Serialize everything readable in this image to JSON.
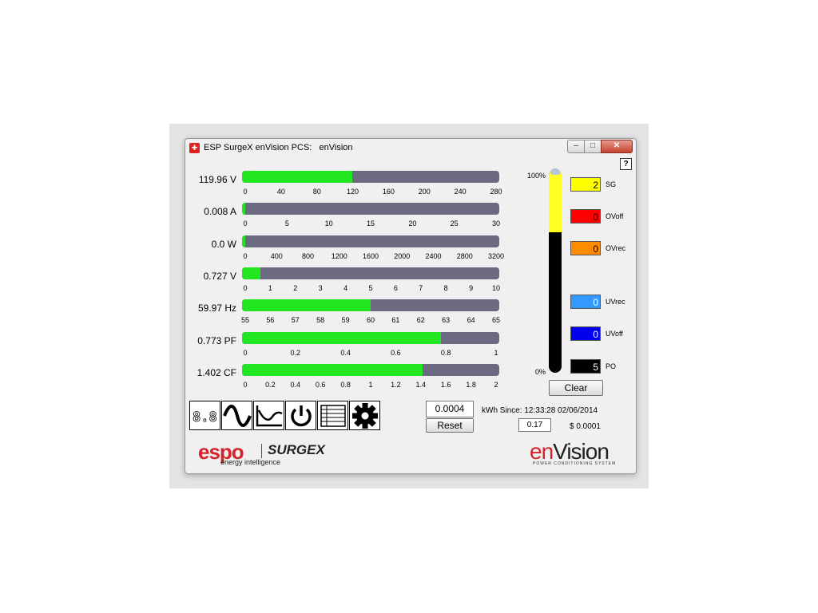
{
  "window": {
    "title": "ESP SurgeX enVision PCS:   enVision",
    "app_icon": "esp-logo-icon",
    "buttons": {
      "minimize": "–",
      "maximize": "□",
      "close": "✕"
    },
    "help_label": "?"
  },
  "meters": [
    {
      "value": "119.96 V",
      "fill": 0.43,
      "ticks": [
        "0",
        "40",
        "80",
        "120",
        "160",
        "200",
        "240",
        "280"
      ]
    },
    {
      "value": "0.008 A",
      "fill": 0.012,
      "ticks": [
        "0",
        "5",
        "10",
        "15",
        "20",
        "25",
        "30"
      ]
    },
    {
      "value": "0.0 W",
      "fill": 0.012,
      "ticks": [
        "0",
        "400",
        "800",
        "1200",
        "1600",
        "2000",
        "2400",
        "2800",
        "3200"
      ]
    },
    {
      "value": "0.727 V",
      "fill": 0.0727,
      "ticks": [
        "0",
        "1",
        "2",
        "3",
        "4",
        "5",
        "6",
        "7",
        "8",
        "9",
        "10"
      ]
    },
    {
      "value": "59.97 Hz",
      "fill": 0.4985,
      "ticks": [
        "55",
        "56",
        "57",
        "58",
        "59",
        "60",
        "61",
        "62",
        "63",
        "64",
        "65"
      ]
    },
    {
      "value": "0.773 PF",
      "fill": 0.773,
      "ticks": [
        "0",
        "0.2",
        "0.4",
        "0.6",
        "0.8",
        "1"
      ]
    },
    {
      "value": "1.402 CF",
      "fill": 0.701,
      "ticks": [
        "0",
        "0.2",
        "0.4",
        "0.6",
        "0.8",
        "1",
        "1.2",
        "1.4",
        "1.6",
        "1.8",
        "2"
      ]
    }
  ],
  "thermometer": {
    "top_label": "100%",
    "bottom_label": "0%",
    "level": 0.31
  },
  "counters": [
    {
      "value": "2",
      "label": "SG",
      "color": "#ffff00",
      "text_color": "#000000"
    },
    {
      "value": "0",
      "label": "OVoff",
      "color": "#ff0000",
      "text_color": "#000000"
    },
    {
      "value": "0",
      "label": "OVrec",
      "color": "#ff8c00",
      "text_color": "#000000"
    },
    {
      "value": "0",
      "label": "UVrec",
      "color": "#3399ff",
      "text_color": "#ffffff"
    },
    {
      "value": "0",
      "label": "UVoff",
      "color": "#0000ee",
      "text_color": "#ffffff"
    },
    {
      "value": "5",
      "label": "PO",
      "color": "#000000",
      "text_color": "#ffffff"
    }
  ],
  "clear_label": "Clear",
  "toolbar_icons": [
    "digital-display-icon",
    "sine-wave-icon",
    "trend-chart-icon",
    "power-icon",
    "list-icon",
    "gear-icon"
  ],
  "energy": {
    "kwh_value": "0.0004",
    "reset_label": "Reset",
    "since_text": "kWh Since: 12:33:28 02/06/2014",
    "rate_value": "0.17",
    "cost_text": "$ 0.0001"
  },
  "logos": {
    "espo": "espo",
    "surgex": "SURGEX",
    "tagline": "energy intelligence",
    "envision_left": "en",
    "envision_right": "Vision",
    "envision_sub": "POWER CONDITIONING SYSTEM"
  },
  "colors": {
    "bar_fill": "#22e622",
    "bar_track": "#6c6a80",
    "thermo_fill": "#ffff22"
  }
}
